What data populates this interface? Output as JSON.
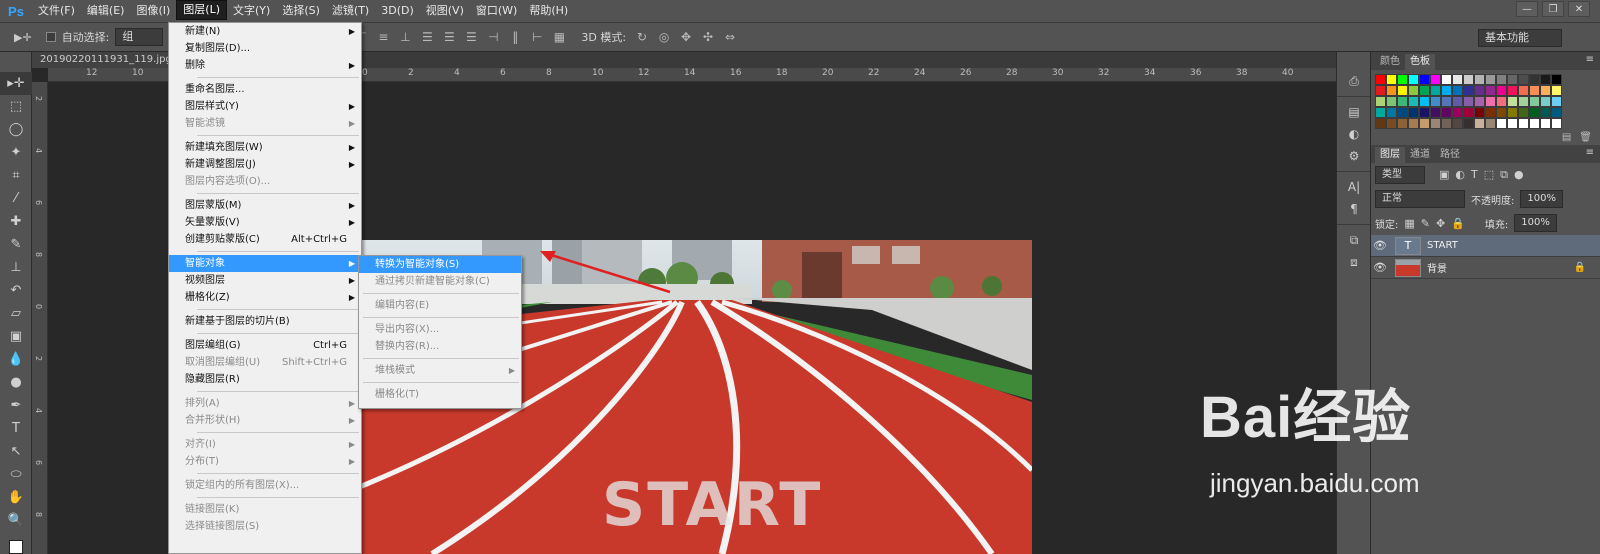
{
  "app": {
    "logo": "Ps"
  },
  "menubar": {
    "items": [
      "文件(F)",
      "编辑(E)",
      "图像(I)",
      "图层(L)",
      "文字(Y)",
      "选择(S)",
      "滤镜(T)",
      "3D(D)",
      "视图(V)",
      "窗口(W)",
      "帮助(H)"
    ],
    "active_index": 3
  },
  "window_controls": {
    "minimize": "—",
    "restore": "❐",
    "close": "✕"
  },
  "options_bar": {
    "auto_select_label": "自动选择:",
    "auto_select_value": "组",
    "mode_3d_label": "3D 模式:",
    "workspace": "基本功能"
  },
  "document": {
    "tab_title": "20190220111931_119.jpg @",
    "ruler_top": [
      "12",
      "10",
      "8",
      "6",
      "4",
      "2",
      "0",
      "2",
      "4",
      "6",
      "8",
      "10",
      "12",
      "14",
      "16",
      "18",
      "20",
      "22",
      "24",
      "26",
      "28",
      "30",
      "32",
      "34",
      "36",
      "38",
      "40"
    ],
    "ruler_left": [
      "2",
      "4",
      "6",
      "8",
      "0",
      "2",
      "4",
      "6",
      "8"
    ],
    "image_text": "START"
  },
  "layer_menu": {
    "items": [
      {
        "label": "新建(N)",
        "arrow": true
      },
      {
        "label": "复制图层(D)..."
      },
      {
        "label": "删除",
        "arrow": true
      },
      {
        "sep": true
      },
      {
        "label": "重命名图层..."
      },
      {
        "label": "图层样式(Y)",
        "arrow": true
      },
      {
        "label": "智能滤镜",
        "disabled": true,
        "arrow": true
      },
      {
        "sep": true
      },
      {
        "label": "新建填充图层(W)",
        "arrow": true
      },
      {
        "label": "新建调整图层(J)",
        "arrow": true
      },
      {
        "label": "图层内容选项(O)...",
        "disabled": true
      },
      {
        "sep": true
      },
      {
        "label": "图层蒙版(M)",
        "arrow": true
      },
      {
        "label": "矢量蒙版(V)",
        "arrow": true
      },
      {
        "label": "创建剪贴蒙版(C)",
        "shortcut": "Alt+Ctrl+G"
      },
      {
        "sep": true
      },
      {
        "label": "智能对象",
        "arrow": true,
        "highlighted": true
      },
      {
        "label": "视频图层",
        "arrow": true
      },
      {
        "label": "栅格化(Z)",
        "arrow": true
      },
      {
        "sep": true
      },
      {
        "label": "新建基于图层的切片(B)"
      },
      {
        "sep": true
      },
      {
        "label": "图层编组(G)",
        "shortcut": "Ctrl+G"
      },
      {
        "label": "取消图层编组(U)",
        "shortcut": "Shift+Ctrl+G",
        "disabled": true
      },
      {
        "label": "隐藏图层(R)"
      },
      {
        "sep": true
      },
      {
        "label": "排列(A)",
        "disabled": true,
        "arrow": true
      },
      {
        "label": "合并形状(H)",
        "disabled": true,
        "arrow": true
      },
      {
        "sep": true
      },
      {
        "label": "对齐(I)",
        "disabled": true,
        "arrow": true
      },
      {
        "label": "分布(T)",
        "disabled": true,
        "arrow": true
      },
      {
        "sep": true
      },
      {
        "label": "锁定组内的所有图层(X)...",
        "disabled": true
      },
      {
        "sep": true
      },
      {
        "label": "链接图层(K)",
        "disabled": true
      },
      {
        "label": "选择链接图层(S)",
        "disabled": true
      }
    ]
  },
  "smart_object_submenu": {
    "items": [
      {
        "label": "转换为智能对象(S)",
        "highlighted": true
      },
      {
        "label": "通过拷贝新建智能对象(C)",
        "disabled": true
      },
      {
        "sep": true
      },
      {
        "label": "编辑内容(E)",
        "disabled": true
      },
      {
        "sep": true
      },
      {
        "label": "导出内容(X)...",
        "disabled": true
      },
      {
        "label": "替换内容(R)...",
        "disabled": true
      },
      {
        "sep": true
      },
      {
        "label": "堆栈模式",
        "disabled": true,
        "arrow": true
      },
      {
        "sep": true
      },
      {
        "label": "栅格化(T)",
        "disabled": true
      }
    ]
  },
  "swatch_panel": {
    "tabs": [
      "颜色",
      "色板"
    ],
    "active_tab": 1
  },
  "layers_panel": {
    "tabs": [
      "图层",
      "通道",
      "路径"
    ],
    "filter_kind": "类型",
    "blend_mode": "正常",
    "opacity_label": "不透明度:",
    "opacity_value": "100%",
    "lock_label": "锁定:",
    "fill_label": "填充:",
    "fill_value": "100%",
    "layers": [
      {
        "name": "START",
        "type": "text",
        "selected": true
      },
      {
        "name": "背景",
        "type": "image",
        "locked": true
      }
    ]
  },
  "watermark": {
    "logo": "Bai经验",
    "url": "jingyan.baidu.com"
  },
  "colors": {
    "menu_highlight": "#3399ff",
    "track_red": "#c8392b",
    "accent_blue": "#31a8ff"
  }
}
